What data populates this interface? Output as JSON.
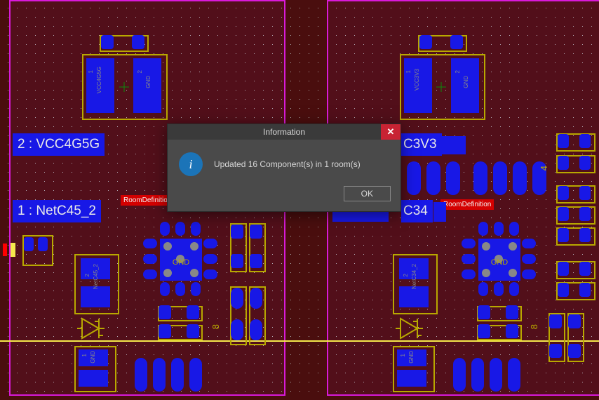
{
  "dialog": {
    "title": "Information",
    "message": "Updated 16 Component(s) in 1 room(s)",
    "ok_label": "OK",
    "close_glyph": "✕"
  },
  "rooms": {
    "left_tag": "RoomDefinition",
    "right_tag": "RoomDefinition"
  },
  "nets": {
    "left_top": "2 : VCC4G5G",
    "left_bottom": "1 : NetC45_2",
    "right_top": "C3V3",
    "right_bottom": "C34"
  },
  "gnd_label": "GND",
  "pin_labels": {
    "l_cap_top_left_num": "1",
    "l_cap_top_left_net": "VCC4G5G",
    "l_cap_top_right_num": "2",
    "l_cap_top_right_net": "GND",
    "r_cap_top_left_num": "1",
    "r_cap_top_left_net": "VCC3V3",
    "r_cap_top_right_num": "2",
    "r_cap_top_right_net": "GND",
    "l_cap_mid_num1": "2",
    "l_cap_mid_net": "NetC45_2",
    "r_cap_mid_num1": "2",
    "r_cap_mid_net": "NetC34_2",
    "l_bot_num": "1",
    "l_bot_net": "GND",
    "r_bot_num": "1",
    "r_bot_net": "GND"
  },
  "silk": {
    "four": "4",
    "eight": "8"
  }
}
